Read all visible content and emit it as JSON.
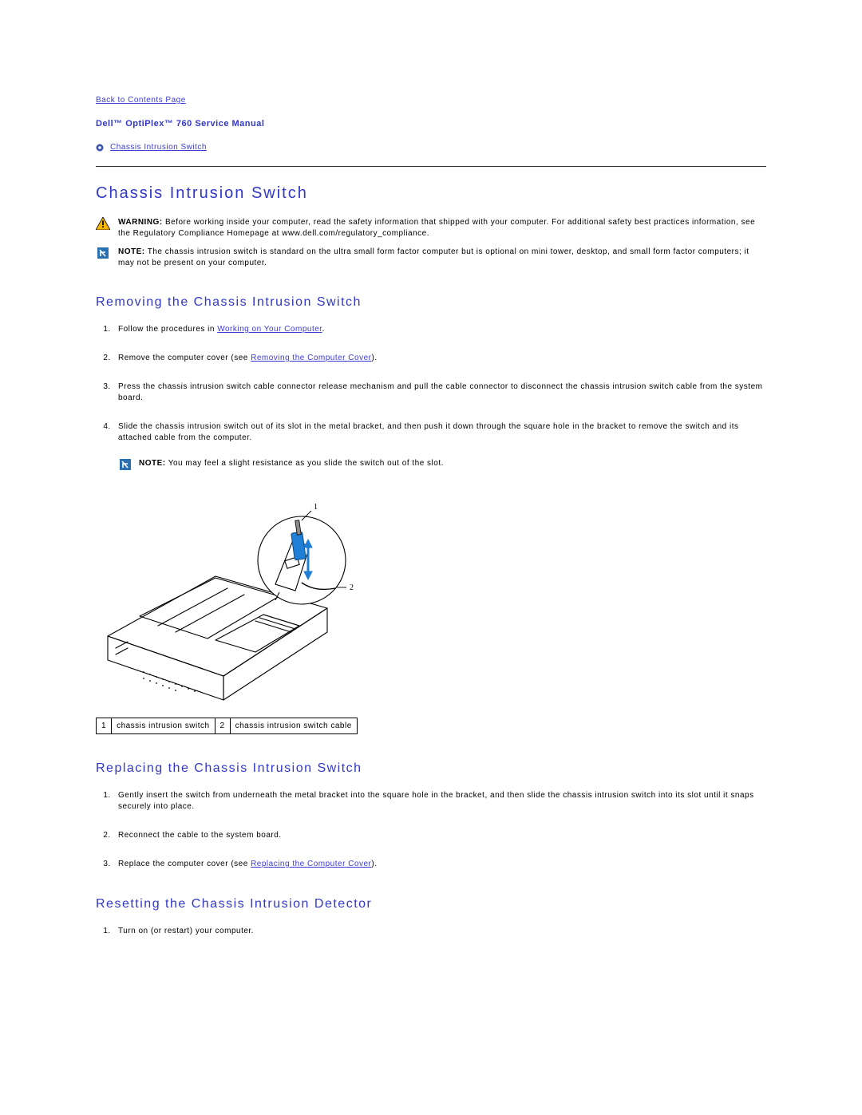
{
  "nav": {
    "back_link": "Back to Contents Page"
  },
  "manual_title": "Dell™ OptiPlex™ 760 Service Manual",
  "toc": {
    "item1": "Chassis Intrusion Switch"
  },
  "section": {
    "title": "Chassis Intrusion Switch",
    "warning_label": "WARNING:",
    "warning_text": " Before working inside your computer, read the safety information that shipped with your computer. For additional safety best practices information, see the Regulatory Compliance Homepage at www.dell.com/regulatory_compliance.",
    "note_label": "NOTE:",
    "note_text": " The chassis intrusion switch is standard on the ultra small form factor computer but is optional on mini tower, desktop, and small form factor computers; it may not be present on your computer."
  },
  "removing": {
    "title": "Removing the Chassis Intrusion Switch",
    "step1_pre": "Follow the procedures in ",
    "step1_link": "Working on Your Computer",
    "step1_post": ".",
    "step2_pre": "Remove the computer cover (see ",
    "step2_link": "Removing the Computer Cover",
    "step2_post": ").",
    "step3": "Press the chassis intrusion switch cable connector release mechanism and pull the cable connector to disconnect the chassis intrusion switch cable from the system board.",
    "step4": "Slide the chassis intrusion switch out of its slot in the metal bracket, and then push it down through the square hole in the bracket to remove the switch and its attached cable from the computer.",
    "step4_note_label": "NOTE:",
    "step4_note_text": " You may feel a slight resistance as you slide the switch out of the slot."
  },
  "legend": {
    "num1": "1",
    "label1": "chassis intrusion switch",
    "num2": "2",
    "label2": "chassis intrusion switch cable"
  },
  "replacing": {
    "title": "Replacing the Chassis Intrusion Switch",
    "step1": "Gently insert the switch from underneath the metal bracket into the square hole in the bracket, and then slide the chassis intrusion switch into its slot until it snaps securely into place.",
    "step2": "Reconnect the cable to the system board.",
    "step3_pre": "Replace the computer cover (see ",
    "step3_link": "Replacing the Computer Cover",
    "step3_post": ")."
  },
  "resetting": {
    "title": "Resetting the Chassis Intrusion Detector",
    "step1": "Turn on (or restart) your computer."
  },
  "callouts": {
    "c1": "1",
    "c2": "2"
  }
}
